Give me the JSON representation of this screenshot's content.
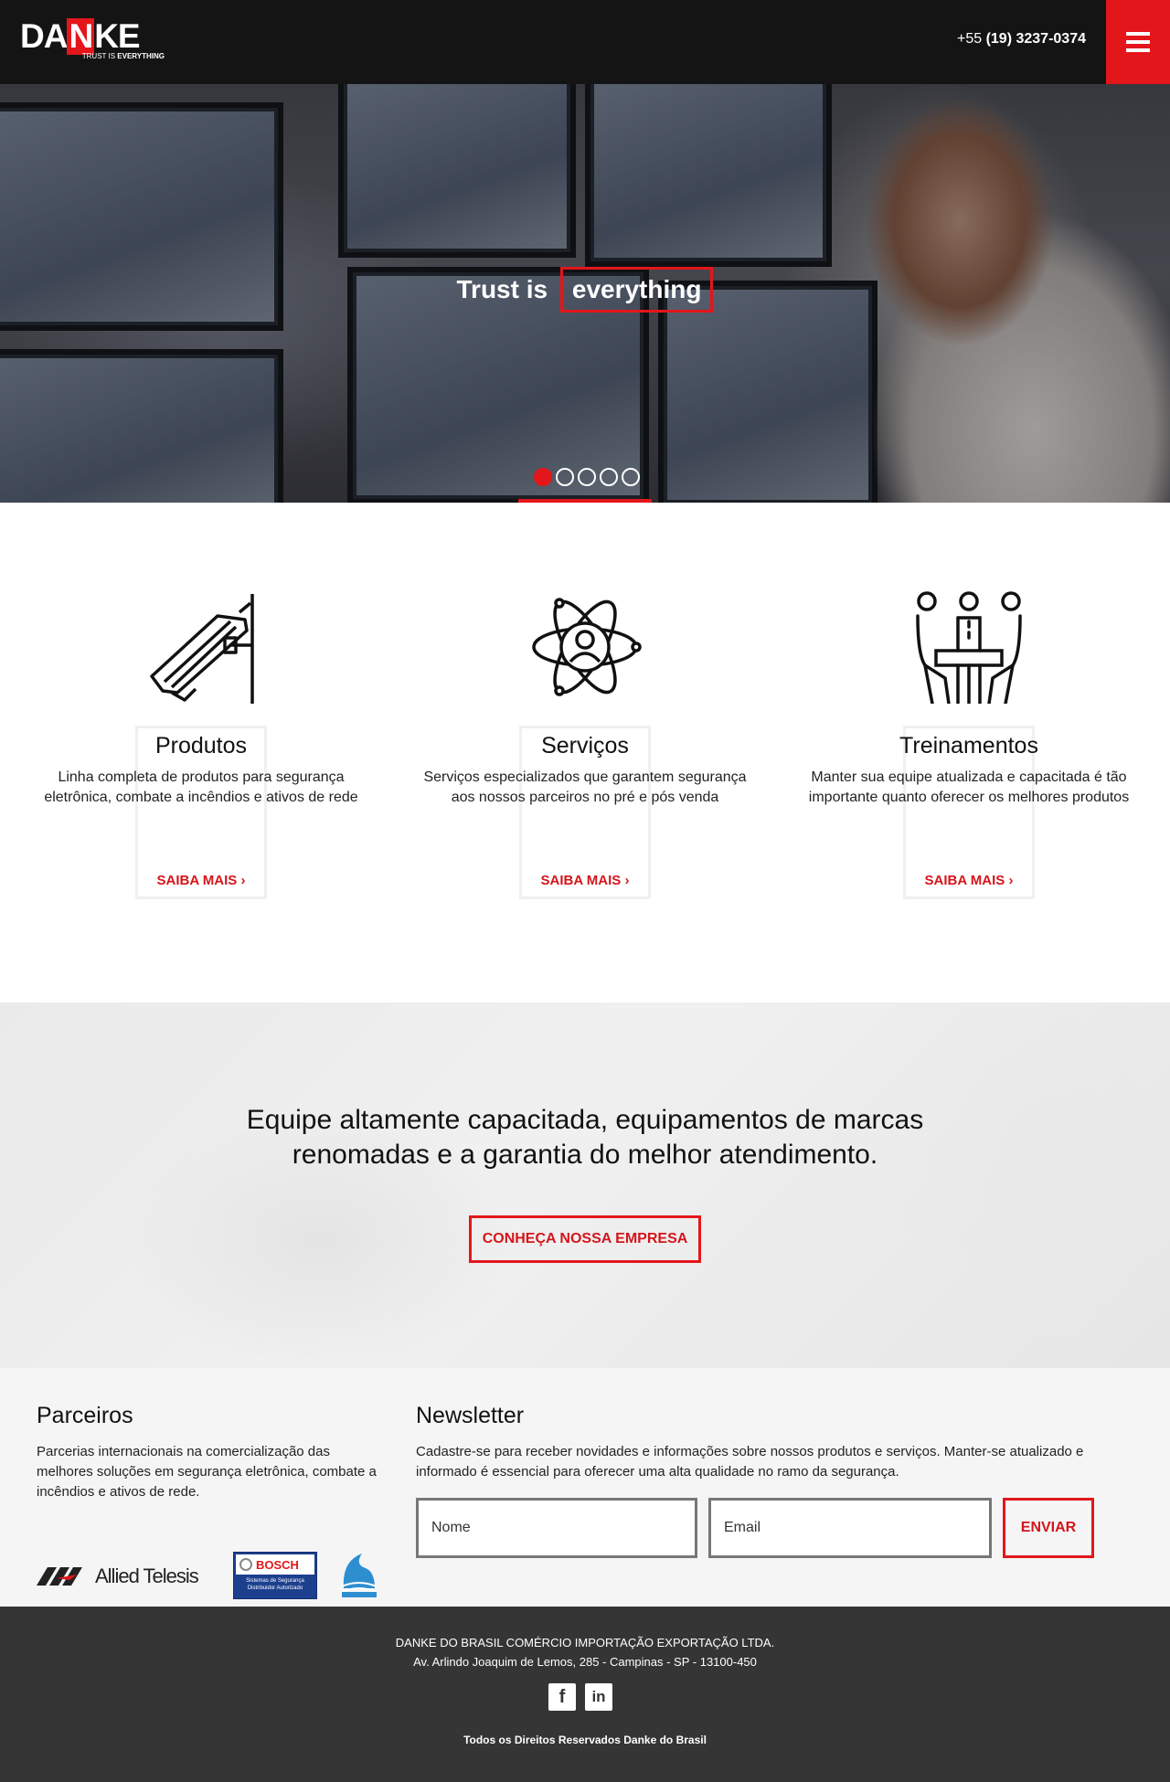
{
  "header": {
    "logo": {
      "word_a": "DA",
      "word_n": "N",
      "word_b": "KE",
      "tag_a": "TRUST IS ",
      "tag_b": "EVERYTHING"
    },
    "phone_prefix": "+55",
    "phone_number": "(19) 3237-0374",
    "menu_icon": "hamburger-icon",
    "accent_color": "#e3161b"
  },
  "hero": {
    "title_a": "Trust is",
    "title_b": "everything",
    "slides_total": 5,
    "active_slide": 1
  },
  "features": [
    {
      "icon": "security-camera-icon",
      "title": "Produtos",
      "text": "Linha completa de produtos para segurança eletrônica, combate a incêndios e ativos de rede",
      "link": "SAIBA MAIS ›"
    },
    {
      "icon": "atom-person-icon",
      "title": "Serviços",
      "text": "Serviços especializados que garantem segurança aos nossos parceiros no pré e pós venda",
      "link": "SAIBA MAIS ›"
    },
    {
      "icon": "meeting-people-icon",
      "title": "Treinamentos",
      "text": "Manter sua equipe atualizada e capacitada é tão importante quanto oferecer os melhores produtos",
      "link": "SAIBA MAIS ›"
    }
  ],
  "banner": {
    "headline": "Equipe altamente capacitada, equipamentos de marcas renomadas e a garantia do melhor atendimento.",
    "cta": "CONHEÇA NOSSA EMPRESA"
  },
  "partners": {
    "title": "Parceiros",
    "text": "Parcerias internacionais na comercialização das melhores soluções em segurança eletrônica, combate a incêndios e ativos de rede.",
    "logos": {
      "allied": "Allied Telesis",
      "bosch": "BOSCH",
      "bosch_sub": "Sistemas de Segurança Distribuidor Autorizado"
    }
  },
  "newsletter": {
    "title": "Newsletter",
    "text": "Cadastre-se para receber novidades e informações sobre nossos produtos e serviços. Manter-se atualizado e informado é essencial para oferecer uma alta qualidade no ramo da segurança.",
    "name_placeholder": "Nome",
    "email_placeholder": "Email",
    "submit": "ENVIAR"
  },
  "footer": {
    "company": "DANKE DO BRASIL COMÉRCIO IMPORTAÇÃO EXPORTAÇÃO LTDA.",
    "address": "Av. Arlindo Joaquim de Lemos, 285 - Campinas - SP - 13100-450",
    "social_facebook": "f",
    "social_linkedin": "in",
    "copyright": "Todos os Direitos Reservados Danke do Brasil"
  }
}
